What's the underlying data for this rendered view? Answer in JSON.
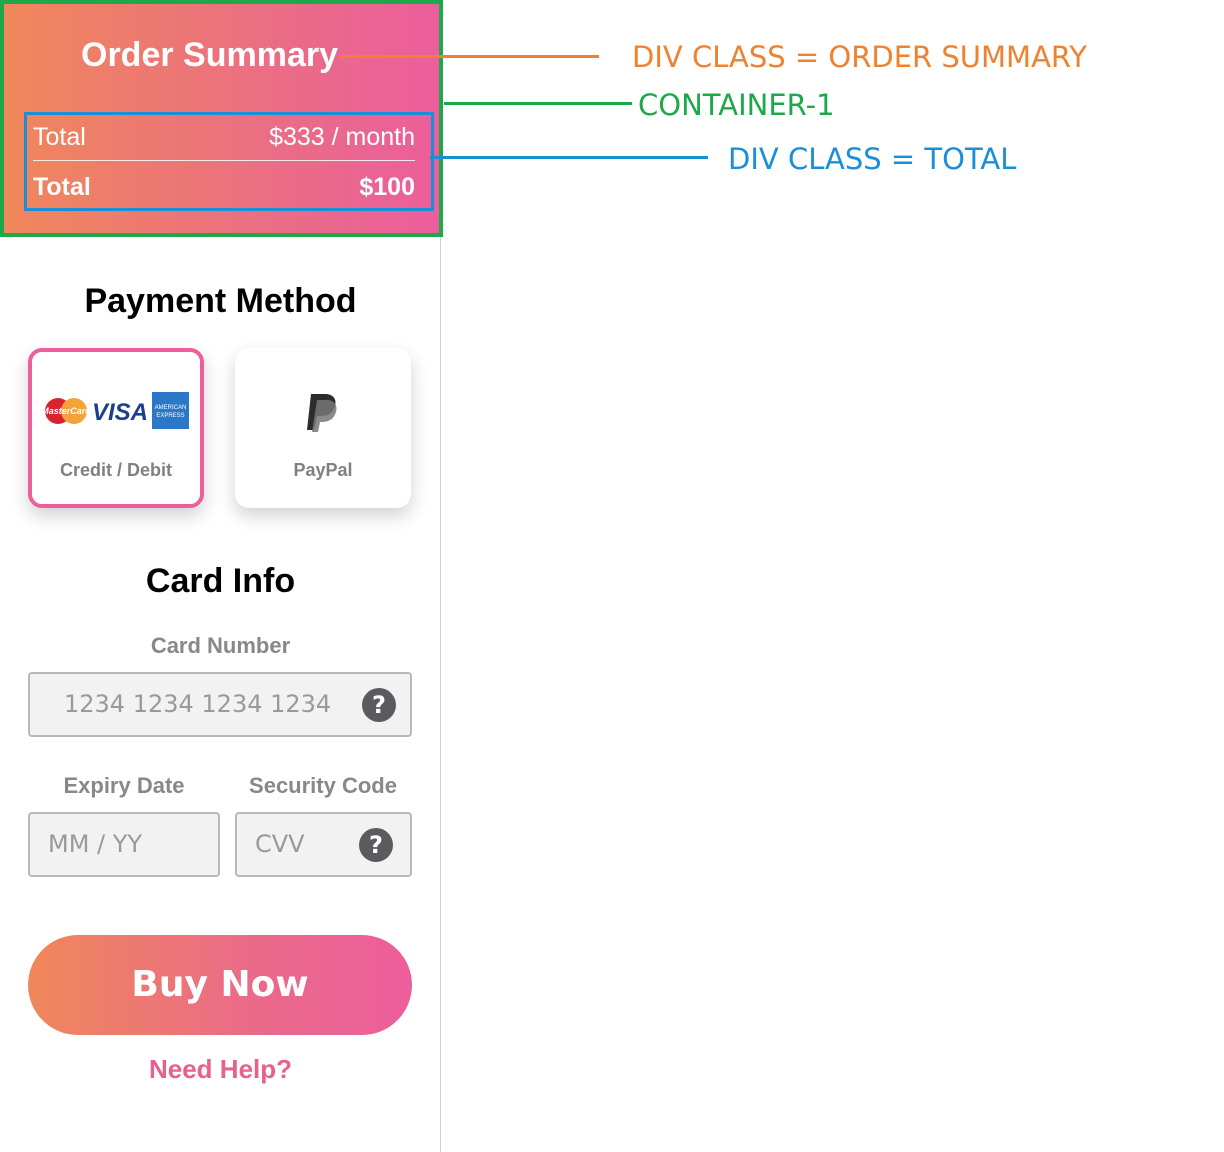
{
  "order_summary": {
    "title": "Order Summary",
    "rows": [
      {
        "label": "Total",
        "value": "$333 / month"
      },
      {
        "label": "Total",
        "value": "$100"
      }
    ]
  },
  "annotations": [
    {
      "text": "DIV CLASS = ORDER SUMMARY",
      "color": "#f0812e"
    },
    {
      "text": "CONTAINER-1",
      "color": "#1fa84a"
    },
    {
      "text": "DIV CLASS = TOTAL",
      "color": "#1a8fd8"
    }
  ],
  "payment": {
    "title": "Payment Method",
    "options": [
      {
        "label": "Credit / Debit",
        "selected": true,
        "logos": [
          "MasterCard",
          "VISA",
          "AMERICAN EXPRESS"
        ]
      },
      {
        "label": "PayPal",
        "selected": false,
        "icon": "paypal-icon"
      }
    ]
  },
  "card_info": {
    "title": "Card Info",
    "card_number_label": "Card Number",
    "card_number_placeholder": "1234 1234 1234 1234",
    "expiry_label": "Expiry Date",
    "expiry_placeholder": "MM / YY",
    "security_label": "Security Code",
    "security_placeholder": "CVV",
    "help_glyph": "?"
  },
  "actions": {
    "buy_label": "Buy Now",
    "help_label": "Need Help?"
  },
  "colors": {
    "gradient_start": "#f0875a",
    "gradient_end": "#ec5e9c",
    "container_outline": "#1fa84a",
    "total_outline": "#1a8fd8",
    "summary_annotation": "#f0812e"
  }
}
